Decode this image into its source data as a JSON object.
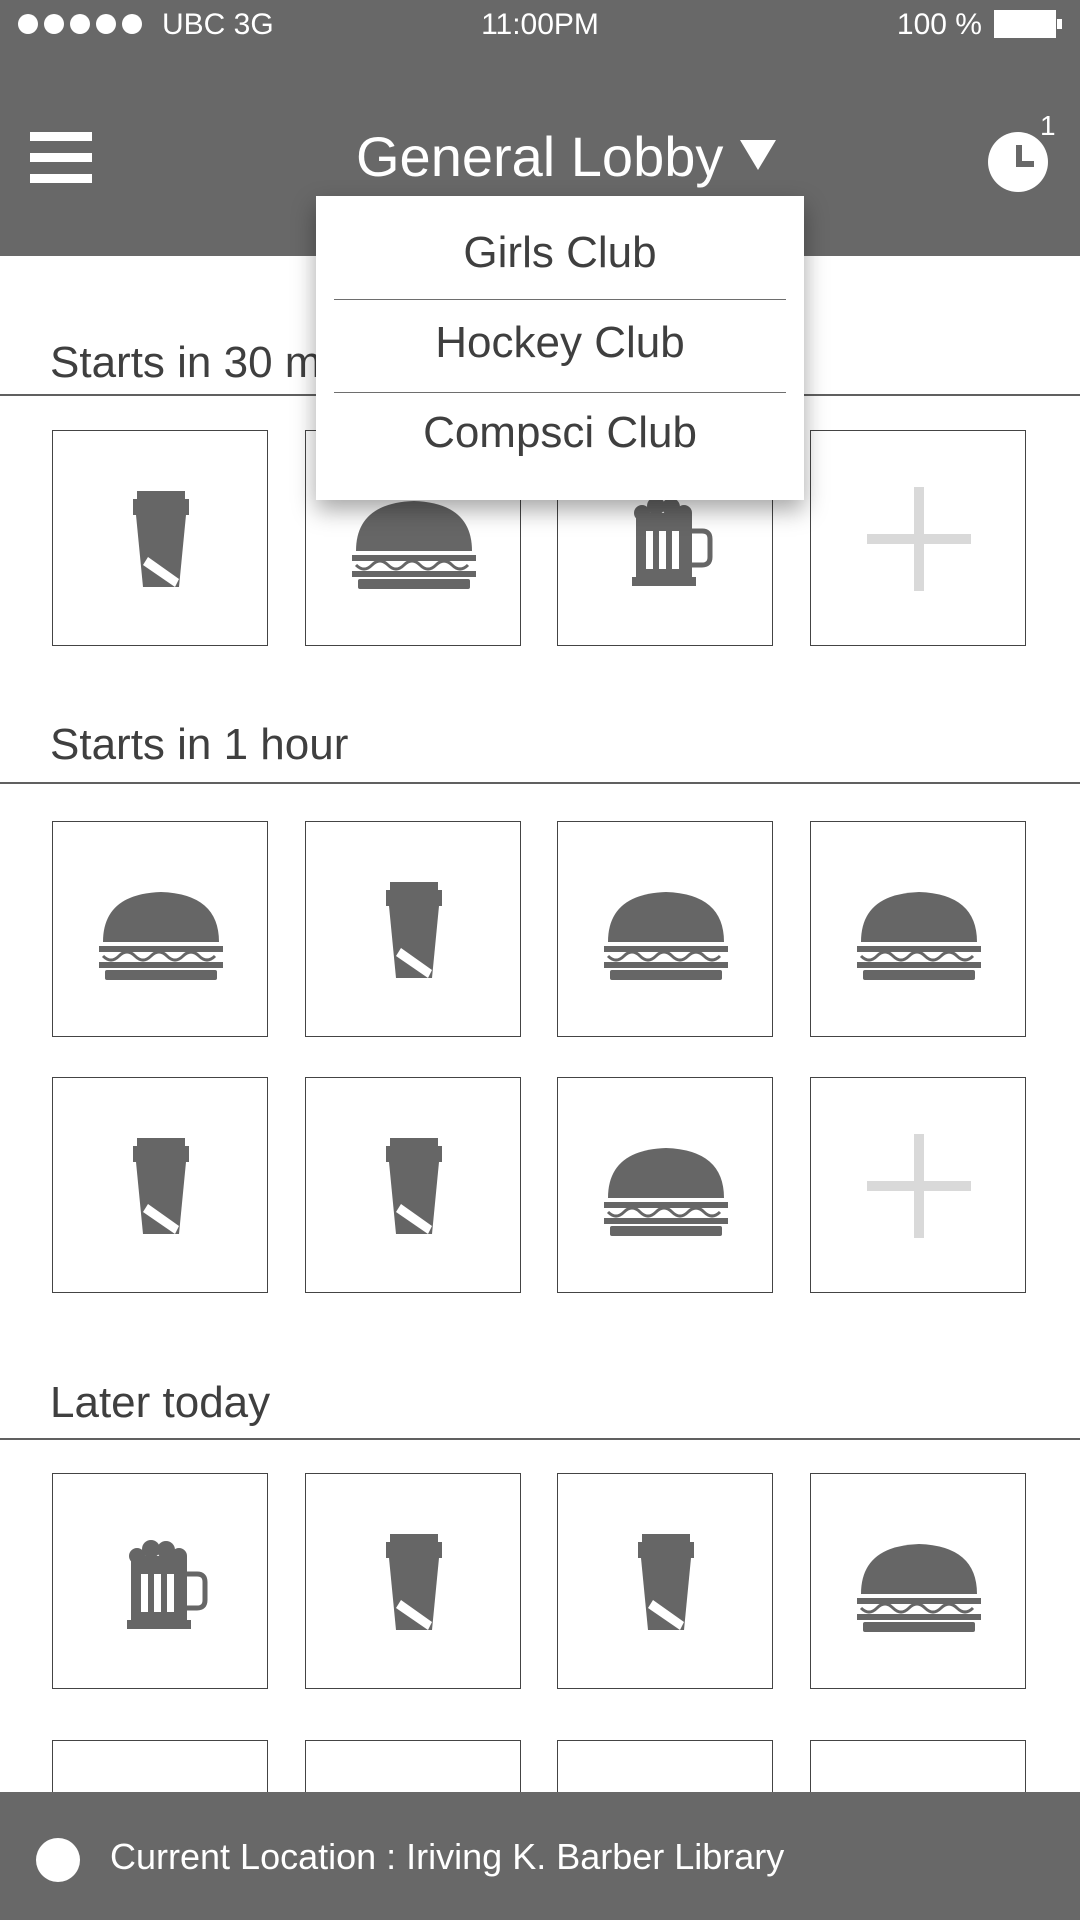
{
  "status_bar": {
    "carrier": "UBC 3G",
    "time": "11:00PM",
    "battery": "100 %"
  },
  "header": {
    "title": "General Lobby",
    "notification_count": "1",
    "icons": [
      "menu-icon",
      "dropdown-arrow-icon",
      "clock-icon"
    ]
  },
  "dropdown": {
    "items": [
      "Girls Club",
      "Hockey Club",
      "Compsci Club"
    ]
  },
  "sections": [
    {
      "title": "Starts in 30 m",
      "tiles": [
        [
          "cup",
          "burger",
          "beer",
          "add"
        ]
      ]
    },
    {
      "title": "Starts in 1 hour",
      "tiles": [
        [
          "burger",
          "cup",
          "burger",
          "burger"
        ],
        [
          "cup",
          "cup",
          "burger",
          "add"
        ]
      ]
    },
    {
      "title": "Later today",
      "tiles": [
        [
          "beer",
          "cup",
          "cup",
          "burger"
        ]
      ]
    }
  ],
  "footer": {
    "location_text": "Current Location : Iriving K. Barber Library"
  },
  "colors": {
    "bar": "#686868",
    "icon": "#666666",
    "add_icon": "#d9d9d9"
  }
}
